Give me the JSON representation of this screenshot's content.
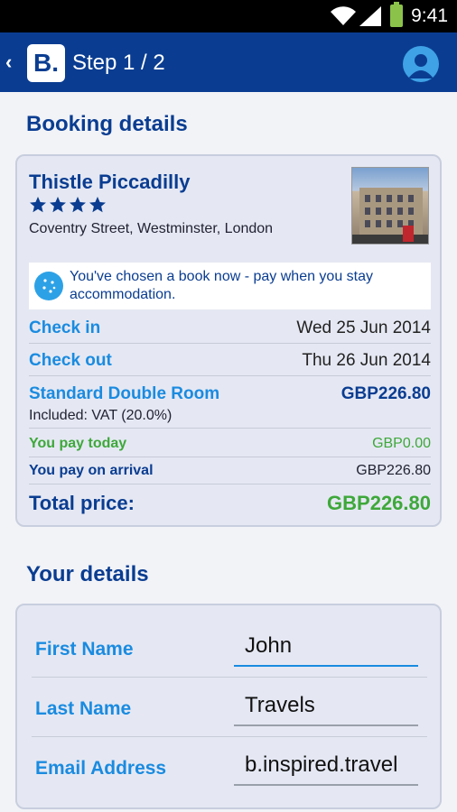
{
  "status_bar": {
    "time": "9:41"
  },
  "app_bar": {
    "back_label": "‹",
    "logo_text": "B.",
    "title": "Step 1 / 2"
  },
  "booking": {
    "section_title": "Booking details",
    "hotel_name": "Thistle Piccadilly",
    "star_count": 4,
    "address": "Coventry Street, Westminster, London",
    "notice": "You've chosen a book now - pay when you stay accommodation.",
    "check_in_label": "Check in",
    "check_in_value": "Wed 25 Jun 2014",
    "check_out_label": "Check out",
    "check_out_value": "Thu 26 Jun 2014",
    "room_label": "Standard Double Room",
    "room_price": "GBP226.80",
    "vat_note": "Included: VAT (20.0%)",
    "pay_today_label": "You pay today",
    "pay_today_value": "GBP0.00",
    "pay_arrival_label": "You pay on arrival",
    "pay_arrival_value": "GBP226.80",
    "total_label": "Total price:",
    "total_value": "GBP226.80"
  },
  "details": {
    "section_title": "Your details",
    "first_name_label": "First Name",
    "first_name_value": "John",
    "last_name_label": "Last Name",
    "last_name_value": "Travels",
    "email_label": "Email Address",
    "email_value": "b.inspired.travel"
  },
  "colors": {
    "brand": "#0a3d91",
    "link": "#1a8be0",
    "success": "#3ea83a"
  }
}
